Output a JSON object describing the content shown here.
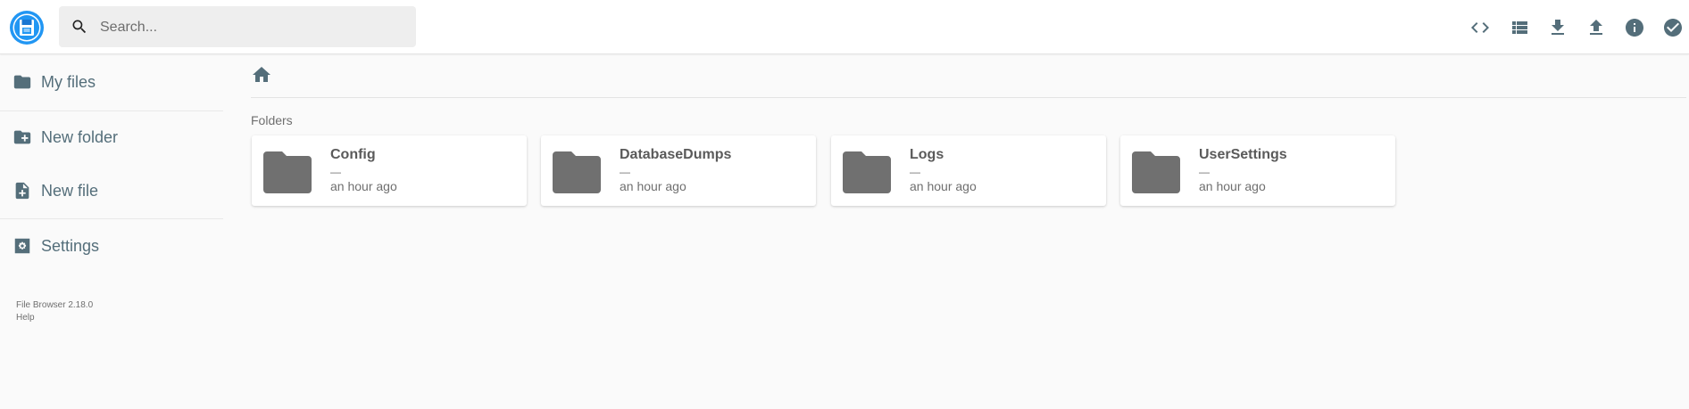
{
  "header": {
    "search_placeholder": "Search...",
    "actions": [
      {
        "name": "toggle-editor-icon",
        "glyph": "code"
      },
      {
        "name": "list-view-icon",
        "glyph": "list"
      },
      {
        "name": "download-icon",
        "glyph": "download"
      },
      {
        "name": "upload-icon",
        "glyph": "upload"
      },
      {
        "name": "info-icon",
        "glyph": "info"
      },
      {
        "name": "select-check-icon",
        "glyph": "check"
      }
    ]
  },
  "sidebar": {
    "items": [
      {
        "label": "My files",
        "icon": "folder-icon"
      },
      {
        "label": "New folder",
        "icon": "folder-plus-icon"
      },
      {
        "label": "New file",
        "icon": "file-plus-icon"
      },
      {
        "label": "Settings",
        "icon": "settings-icon"
      }
    ],
    "credits": {
      "version": "File Browser 2.18.0",
      "help": "Help"
    }
  },
  "main": {
    "section_title": "Folders",
    "folders": [
      {
        "name": "Config",
        "size": "—",
        "modified": "an hour ago"
      },
      {
        "name": "DatabaseDumps",
        "size": "—",
        "modified": "an hour ago"
      },
      {
        "name": "Logs",
        "size": "—",
        "modified": "an hour ago"
      },
      {
        "name": "UserSettings",
        "size": "—",
        "modified": "an hour ago"
      }
    ]
  },
  "colors": {
    "accent": "#2196f3",
    "icon": "#546e7a",
    "folder": "#707070",
    "background": "#fafafa"
  }
}
